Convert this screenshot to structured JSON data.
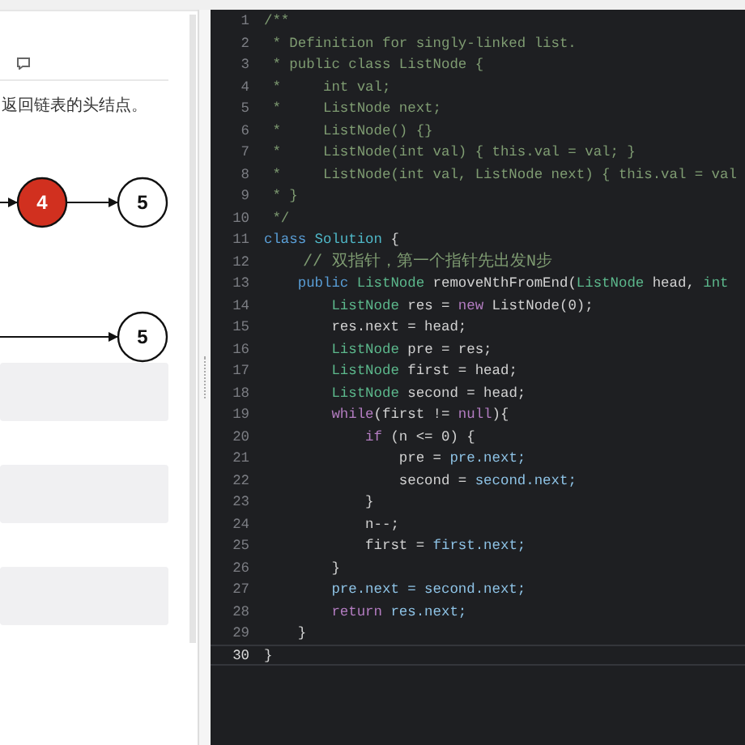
{
  "problem_panel": {
    "description": "返回链表的头结点。",
    "diagram_rows": [
      {
        "nodes": [
          {
            "label": "4",
            "highlighted": true
          },
          {
            "label": "5",
            "highlighted": false
          }
        ]
      },
      {
        "nodes": [
          {
            "label": "5",
            "highlighted": false
          }
        ]
      }
    ]
  },
  "editor": {
    "lines": [
      {
        "number": "1",
        "current": false,
        "tokens": [
          {
            "text": "/**",
            "kind": "comment"
          }
        ]
      },
      {
        "number": "2",
        "current": false,
        "tokens": [
          {
            "text": " * Definition for singly-linked list.",
            "kind": "comment"
          }
        ]
      },
      {
        "number": "3",
        "current": false,
        "tokens": [
          {
            "text": " * public class ListNode {",
            "kind": "comment"
          }
        ]
      },
      {
        "number": "4",
        "current": false,
        "tokens": [
          {
            "text": " *     int val;",
            "kind": "comment"
          }
        ]
      },
      {
        "number": "5",
        "current": false,
        "tokens": [
          {
            "text": " *     ListNode next;",
            "kind": "comment"
          }
        ]
      },
      {
        "number": "6",
        "current": false,
        "tokens": [
          {
            "text": " *     ListNode() {}",
            "kind": "comment"
          }
        ]
      },
      {
        "number": "7",
        "current": false,
        "tokens": [
          {
            "text": " *     ListNode(int val) { this.val = val; }",
            "kind": "comment"
          }
        ]
      },
      {
        "number": "8",
        "current": false,
        "tokens": [
          {
            "text": " *     ListNode(int val, ListNode next) { this.val = val",
            "kind": "comment"
          }
        ]
      },
      {
        "number": "9",
        "current": false,
        "tokens": [
          {
            "text": " * }",
            "kind": "comment"
          }
        ]
      },
      {
        "number": "10",
        "current": false,
        "tokens": [
          {
            "text": " */",
            "kind": "comment"
          }
        ]
      },
      {
        "number": "11",
        "current": false,
        "tokens": [
          {
            "text": "class ",
            "kind": "keyword"
          },
          {
            "text": "Solution ",
            "kind": "class"
          },
          {
            "text": "{",
            "kind": "plain"
          }
        ]
      },
      {
        "number": "12",
        "current": false,
        "tokens": [
          {
            "text": "    // 双指针，第一个指针先出发N步",
            "kind": "note"
          }
        ]
      },
      {
        "number": "13",
        "current": false,
        "tokens": [
          {
            "text": "    public ",
            "kind": "keyword"
          },
          {
            "text": "ListNode ",
            "kind": "type"
          },
          {
            "text": "removeNthFromEnd(",
            "kind": "plain"
          },
          {
            "text": "ListNode ",
            "kind": "type"
          },
          {
            "text": "head, ",
            "kind": "plain"
          },
          {
            "text": "int",
            "kind": "type"
          }
        ]
      },
      {
        "number": "14",
        "current": false,
        "tokens": [
          {
            "text": "        ListNode ",
            "kind": "type"
          },
          {
            "text": "res = ",
            "kind": "plain"
          },
          {
            "text": "new ",
            "kind": "control"
          },
          {
            "text": "ListNode(0);",
            "kind": "plain"
          }
        ]
      },
      {
        "number": "15",
        "current": false,
        "tokens": [
          {
            "text": "        res.next = head;",
            "kind": "plain"
          }
        ]
      },
      {
        "number": "16",
        "current": false,
        "tokens": [
          {
            "text": "        ListNode ",
            "kind": "type"
          },
          {
            "text": "pre = res;",
            "kind": "plain"
          }
        ]
      },
      {
        "number": "17",
        "current": false,
        "tokens": [
          {
            "text": "        ListNode ",
            "kind": "type"
          },
          {
            "text": "first = head;",
            "kind": "plain"
          }
        ]
      },
      {
        "number": "18",
        "current": false,
        "tokens": [
          {
            "text": "        ListNode ",
            "kind": "type"
          },
          {
            "text": "second = head;",
            "kind": "plain"
          }
        ]
      },
      {
        "number": "19",
        "current": false,
        "tokens": [
          {
            "text": "        while",
            "kind": "control"
          },
          {
            "text": "(first != ",
            "kind": "plain"
          },
          {
            "text": "null",
            "kind": "control"
          },
          {
            "text": "){",
            "kind": "plain"
          }
        ]
      },
      {
        "number": "20",
        "current": false,
        "tokens": [
          {
            "text": "            if ",
            "kind": "control"
          },
          {
            "text": "(n <= 0) {",
            "kind": "plain"
          }
        ]
      },
      {
        "number": "21",
        "current": false,
        "tokens": [
          {
            "text": "                pre = ",
            "kind": "plain"
          },
          {
            "text": "pre.next;",
            "kind": "member"
          }
        ]
      },
      {
        "number": "22",
        "current": false,
        "tokens": [
          {
            "text": "                second = ",
            "kind": "plain"
          },
          {
            "text": "second.next;",
            "kind": "member"
          }
        ]
      },
      {
        "number": "23",
        "current": false,
        "tokens": [
          {
            "text": "            }",
            "kind": "plain"
          }
        ]
      },
      {
        "number": "24",
        "current": false,
        "tokens": [
          {
            "text": "            n--;",
            "kind": "plain"
          }
        ]
      },
      {
        "number": "25",
        "current": false,
        "tokens": [
          {
            "text": "            first = ",
            "kind": "plain"
          },
          {
            "text": "first.next;",
            "kind": "member"
          }
        ]
      },
      {
        "number": "26",
        "current": false,
        "tokens": [
          {
            "text": "        }",
            "kind": "plain"
          }
        ]
      },
      {
        "number": "27",
        "current": false,
        "tokens": [
          {
            "text": "        pre.next = second.next;",
            "kind": "member"
          }
        ]
      },
      {
        "number": "28",
        "current": false,
        "tokens": [
          {
            "text": "        return ",
            "kind": "control"
          },
          {
            "text": "res.next;",
            "kind": "member"
          }
        ]
      },
      {
        "number": "29",
        "current": false,
        "tokens": [
          {
            "text": "    }",
            "kind": "plain"
          }
        ]
      },
      {
        "number": "30",
        "current": true,
        "tokens": [
          {
            "text": "}",
            "kind": "plain"
          }
        ]
      }
    ]
  }
}
